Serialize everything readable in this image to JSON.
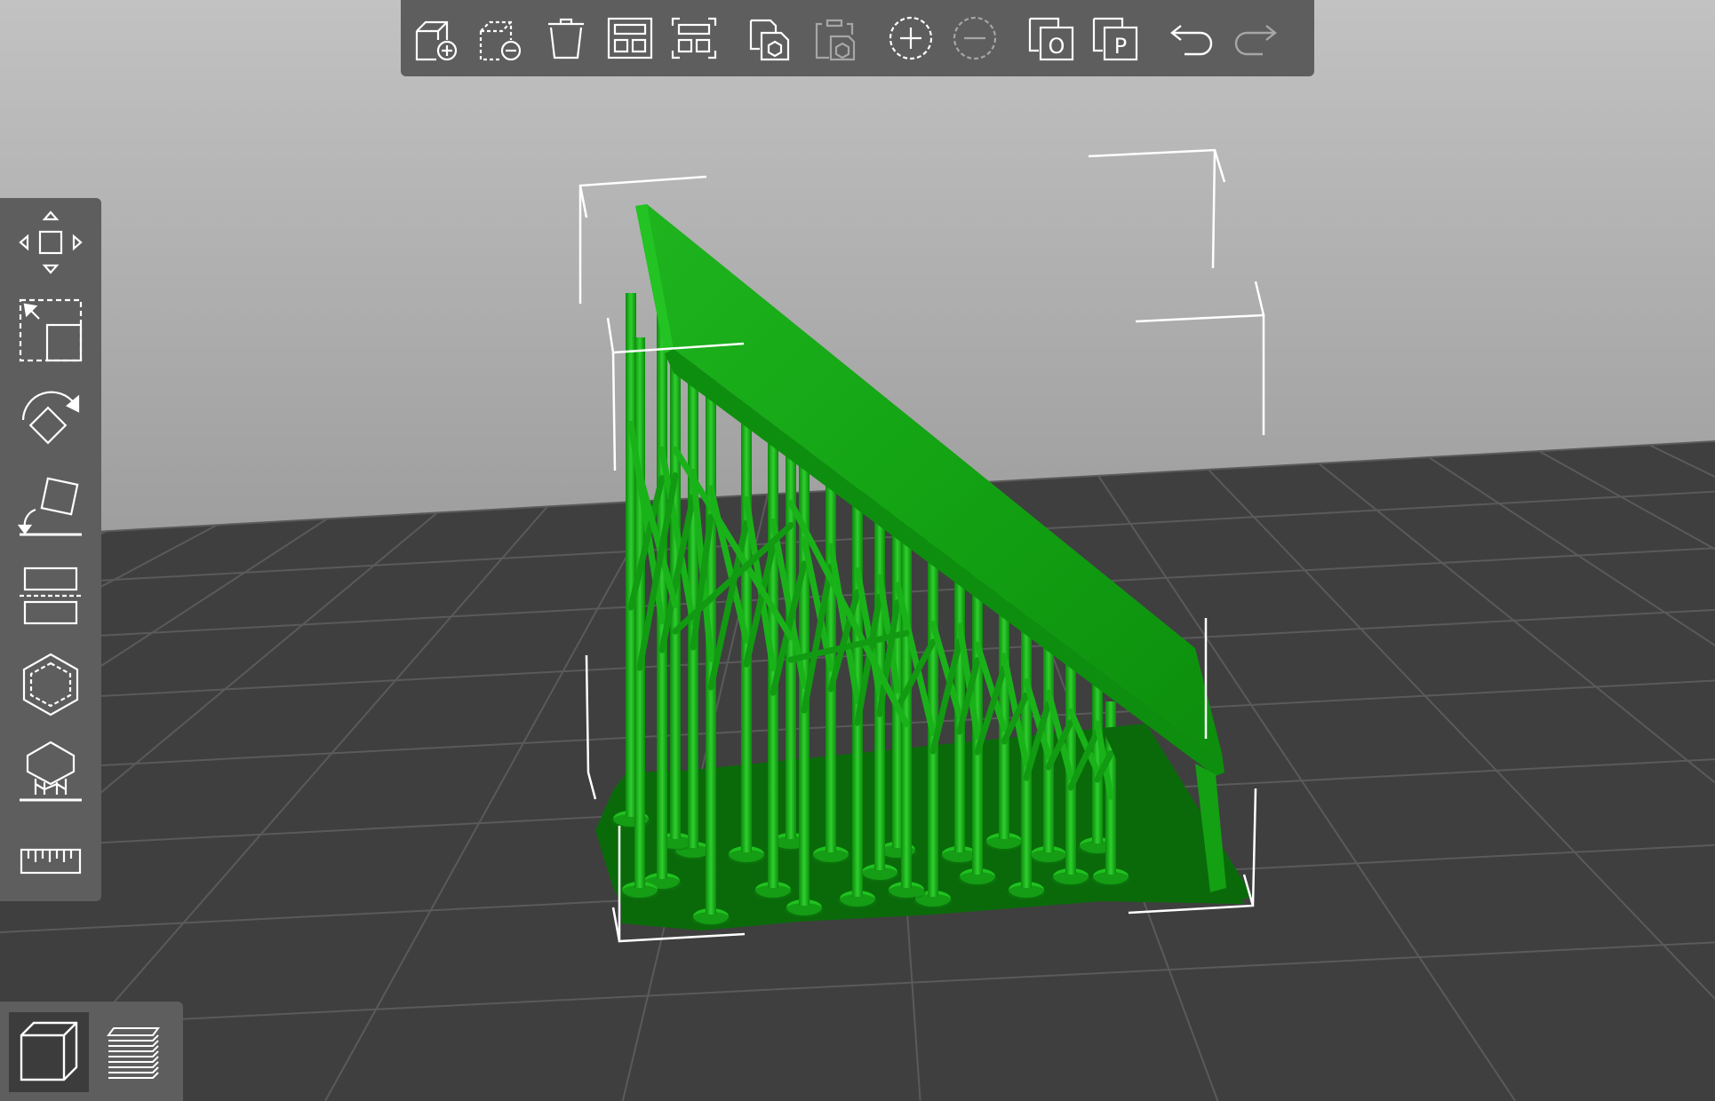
{
  "app": {
    "colors": {
      "viewport_sky_top": "#bdbdbd",
      "viewport_sky_bottom": "#9c9c9c",
      "bed_color": "#3f3f3f",
      "bed_grid": "#5c5c5c",
      "model_green": "#16a816",
      "model_green_dark": "#0a6e0a",
      "toolbar_bg": "#5e5e5e",
      "icon_color": "#ffffff"
    }
  },
  "top_toolbar": {
    "buttons": [
      {
        "name": "add-object-button",
        "icon": "add-cube-icon",
        "enabled": true
      },
      {
        "name": "delete-object-button",
        "icon": "remove-cube-icon",
        "enabled": true
      },
      {
        "name": "delete-all-button",
        "icon": "trash-icon",
        "enabled": true
      },
      {
        "name": "arrange-button",
        "icon": "arrange-icon",
        "enabled": true
      },
      {
        "name": "arrange-selection-button",
        "icon": "arrange-selection-icon",
        "enabled": true
      },
      {
        "name": "copy-button",
        "icon": "copy-icon",
        "enabled": true
      },
      {
        "name": "paste-button",
        "icon": "paste-icon",
        "enabled": false
      },
      {
        "name": "add-instance-button",
        "icon": "plus-circle-icon",
        "enabled": true
      },
      {
        "name": "remove-instance-button",
        "icon": "minus-circle-icon",
        "enabled": false
      },
      {
        "name": "split-objects-button",
        "icon": "split-objects-icon",
        "enabled": true
      },
      {
        "name": "split-parts-button",
        "icon": "split-parts-icon",
        "enabled": true
      },
      {
        "name": "undo-button",
        "icon": "undo-icon",
        "enabled": true
      },
      {
        "name": "redo-button",
        "icon": "redo-icon",
        "enabled": false
      }
    ],
    "split_objects_letter": "O",
    "split_parts_letter": "P"
  },
  "left_toolbar": {
    "tools": [
      {
        "name": "move-tool",
        "icon": "move-arrows-icon"
      },
      {
        "name": "scale-tool",
        "icon": "scale-icon"
      },
      {
        "name": "rotate-tool",
        "icon": "rotate-icon"
      },
      {
        "name": "place-on-face-tool",
        "icon": "place-on-face-icon"
      },
      {
        "name": "cut-tool",
        "icon": "cut-icon"
      },
      {
        "name": "hollow-tool",
        "icon": "hollow-icon"
      },
      {
        "name": "sla-support-points-tool",
        "icon": "support-points-icon"
      },
      {
        "name": "measure-tool",
        "icon": "ruler-icon"
      }
    ]
  },
  "view_toolbar": {
    "buttons": [
      {
        "name": "3d-view-button",
        "icon": "cube-view-icon",
        "active": true
      },
      {
        "name": "preview-button",
        "icon": "layers-icon",
        "active": false
      }
    ]
  }
}
